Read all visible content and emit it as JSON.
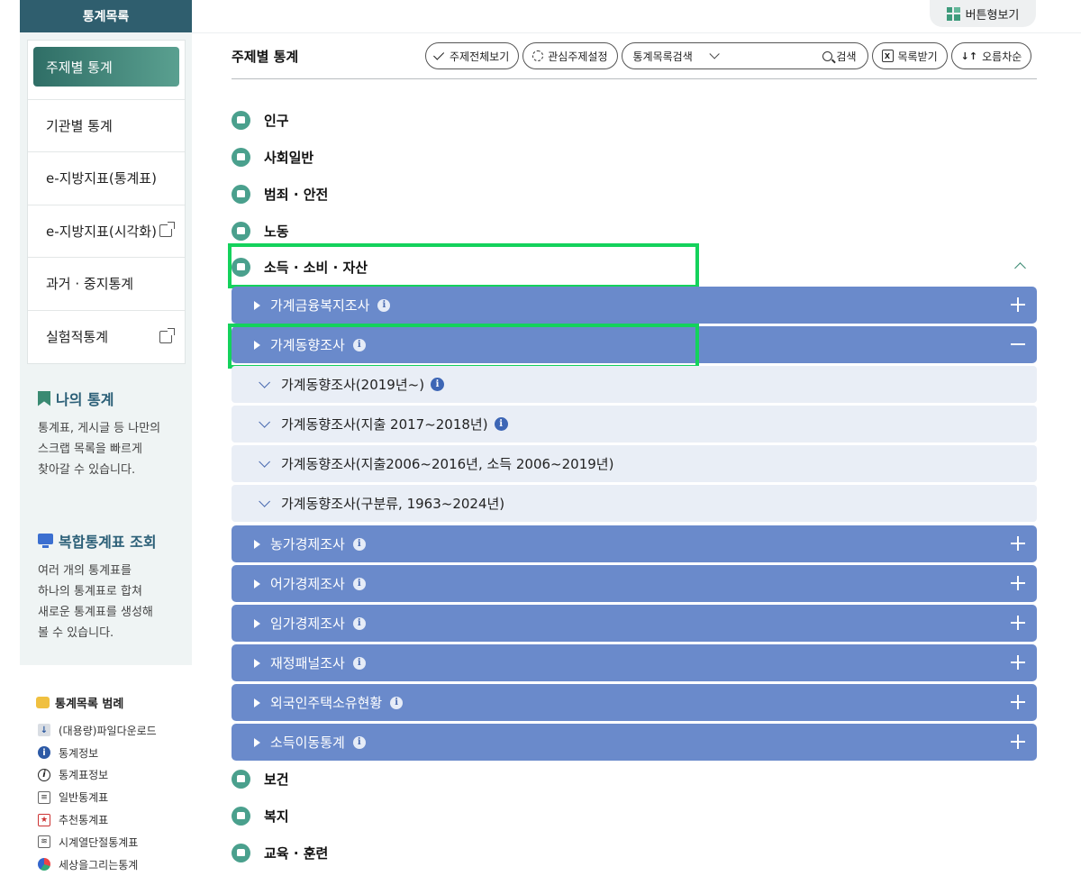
{
  "sidebar": {
    "header": "통계목록",
    "menu": [
      {
        "label": "주제별 통계",
        "external": false
      },
      {
        "label": "기관별 통계",
        "external": false
      },
      {
        "label": "e-지방지표(통계표)",
        "external": false
      },
      {
        "label": "e-지방지표(시각화)",
        "external": true
      },
      {
        "label": "과거 · 중지통계",
        "external": false
      },
      {
        "label": "실험적통계",
        "external": true
      }
    ],
    "my_stats": {
      "title": "나의 통계",
      "desc": "통계표, 게시글 등 나만의\n스크랩 목록을 빠르게\n찾아갈 수 있습니다."
    },
    "compound": {
      "title": "복합통계표 조회",
      "desc": "여러 개의 통계표를\n하나의 통계표로 합쳐\n새로운 통계표를 생성해\n볼 수 있습니다."
    },
    "legend": {
      "title": "통계목록 범례",
      "items": [
        {
          "label": "(대용량)파일다운로드",
          "icon": "download-icon"
        },
        {
          "label": "통계정보",
          "icon": "info-filled-icon"
        },
        {
          "label": "통계표정보",
          "icon": "info-outline-icon"
        },
        {
          "label": "일반통계표",
          "icon": "table-icon"
        },
        {
          "label": "추천통계표",
          "icon": "recommend-icon"
        },
        {
          "label": "시계열단절통계표",
          "icon": "timeseries-icon"
        },
        {
          "label": "세상을그리는통계",
          "icon": "globe-icon"
        }
      ]
    }
  },
  "topbar": {
    "view_button": "버튼형보기"
  },
  "main": {
    "title": "주제별 통계",
    "toolbar": {
      "all_topics": "주제전체보기",
      "interest": "관심주제설정",
      "search_select": "통계목록검색",
      "search_button": "검색",
      "download": "목록받기",
      "sort": "오름차순"
    },
    "categories_top": [
      "인구",
      "사회일반",
      "범죄 · 안전",
      "노동",
      "소득 · 소비 · 자산"
    ],
    "surveys_before": [
      {
        "label": "가계금융복지조사",
        "info": true,
        "expanded": false
      }
    ],
    "expanded_survey": {
      "label": "가계동향조사",
      "info": true,
      "expanded": true
    },
    "subitems": [
      {
        "label": "가계동향조사(2019년~)",
        "info": true
      },
      {
        "label": "가계동향조사(지출 2017~2018년)",
        "info": true
      },
      {
        "label": "가계동향조사(지출2006~2016년, 소득 2006~2019년)",
        "info": false
      },
      {
        "label": "가계동향조사(구분류, 1963~2024년)",
        "info": false
      }
    ],
    "surveys_after": [
      {
        "label": "농가경제조사",
        "info": true
      },
      {
        "label": "어가경제조사",
        "info": true
      },
      {
        "label": "임가경제조사",
        "info": true
      },
      {
        "label": "재정패널조사",
        "info": true
      },
      {
        "label": "외국인주택소유현황",
        "info": true
      },
      {
        "label": "소득이동통계",
        "info": true
      }
    ],
    "categories_bottom": [
      "보건",
      "복지",
      "교육 · 훈련"
    ]
  },
  "colors": {
    "survey_bg": "#6a8acb",
    "subitem_bg": "#e9eef6",
    "highlight": "#14d25c",
    "accent": "#3a8a72"
  }
}
